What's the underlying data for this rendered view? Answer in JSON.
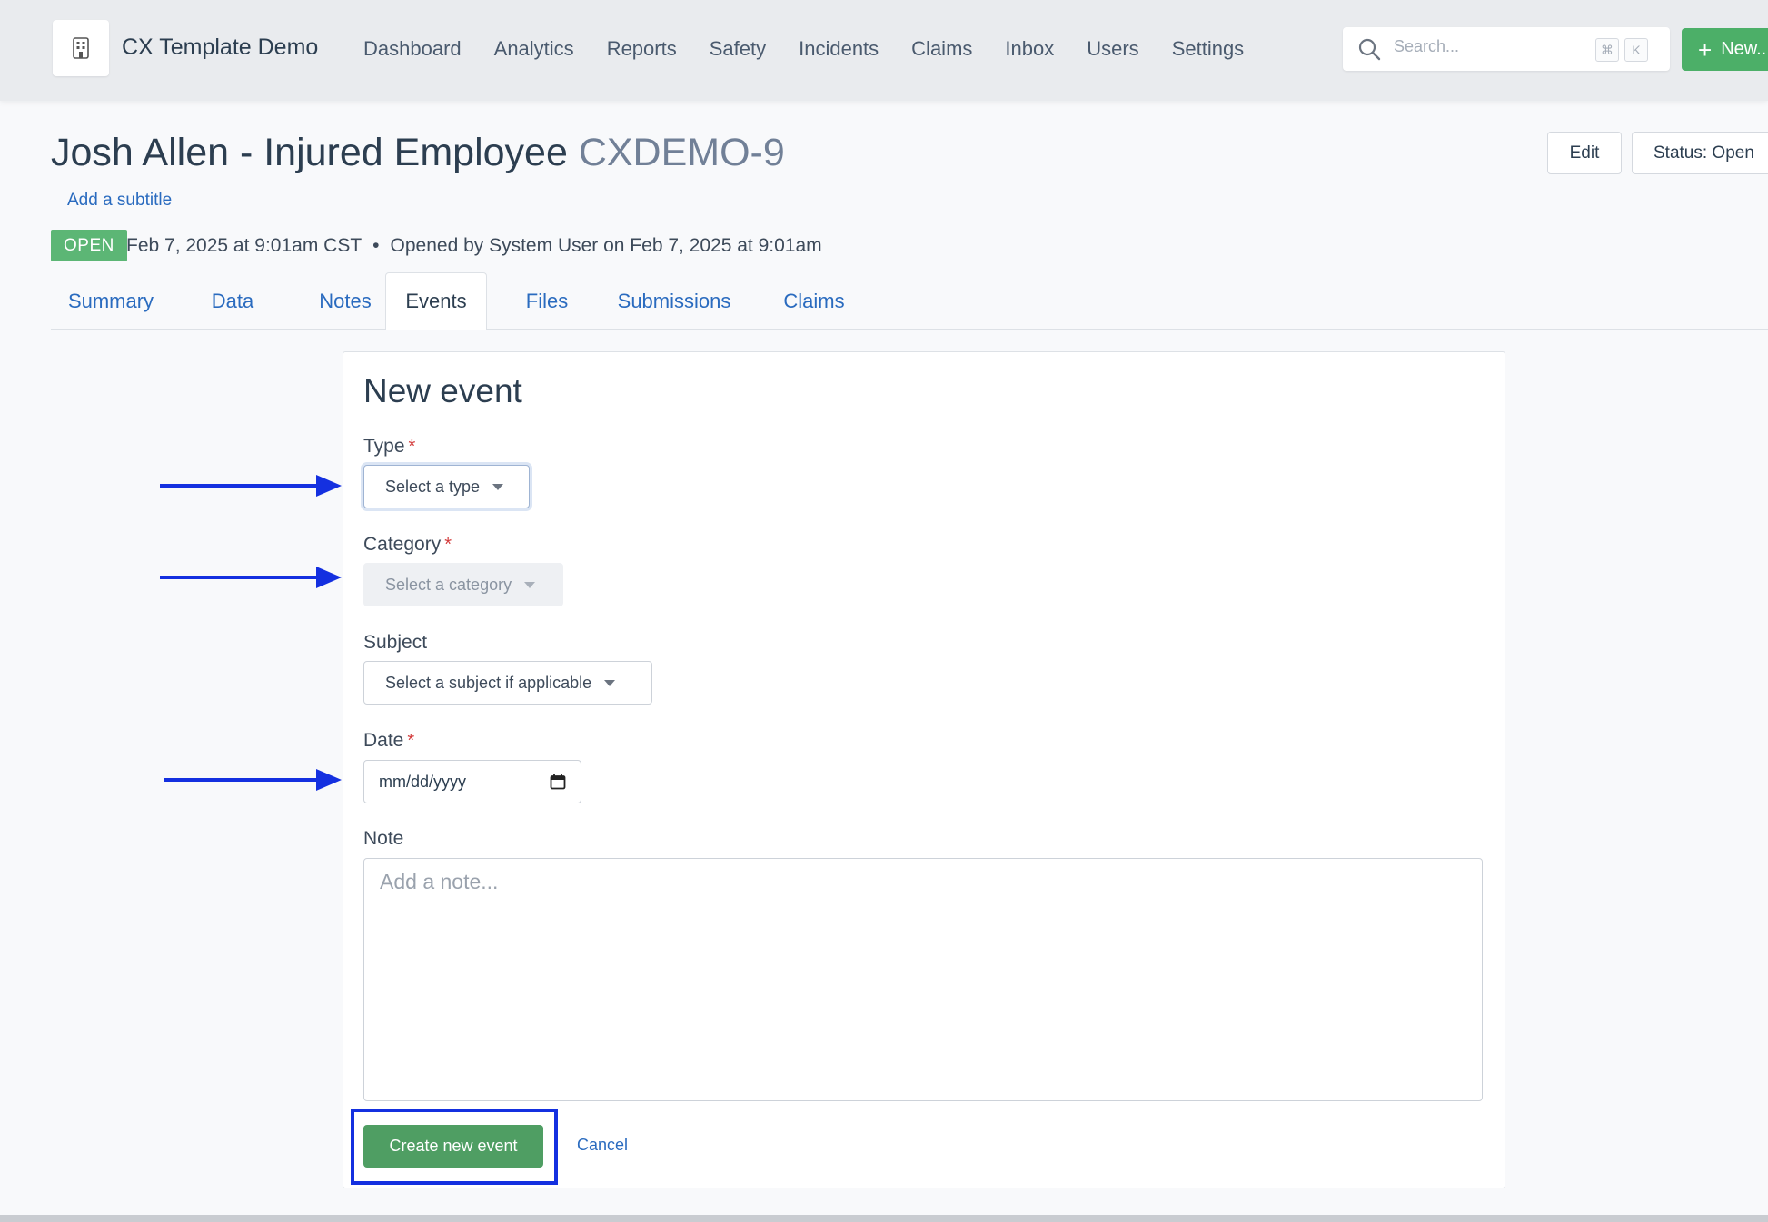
{
  "app": {
    "title": "CX Template Demo"
  },
  "nav": {
    "items": [
      "Dashboard",
      "Analytics",
      "Reports",
      "Safety",
      "Incidents",
      "Claims",
      "Inbox",
      "Users",
      "Settings"
    ]
  },
  "search": {
    "placeholder": "Search...",
    "shortcut_cmd": "⌘",
    "shortcut_key": "K"
  },
  "new_button": {
    "label": "New..."
  },
  "record": {
    "title": "Josh Allen - Injured Employee",
    "code": "CXDEMO-9",
    "subtitle_link": "Add a subtitle",
    "status_badge": "OPEN",
    "date": "Feb 7, 2025 at 9:01am CST",
    "opened_by": "Opened by System User on Feb 7, 2025 at 9:01am"
  },
  "actions": {
    "edit": "Edit",
    "status": "Status: Open"
  },
  "tabs": [
    "Summary",
    "Data",
    "Notes",
    "Events",
    "Files",
    "Submissions",
    "Claims"
  ],
  "active_tab": "Events",
  "form": {
    "title": "New event",
    "type_label": "Type",
    "type_placeholder": "Select a type",
    "category_label": "Category",
    "category_placeholder": "Select a category",
    "subject_label": "Subject",
    "subject_placeholder": "Select a subject if applicable",
    "date_label": "Date",
    "date_placeholder": "mm/dd/yyyy",
    "note_label": "Note",
    "note_placeholder": "Add a note...",
    "required_mark": "*",
    "submit": "Create new event",
    "cancel": "Cancel"
  },
  "colors": {
    "accent_green": "#4f9e63",
    "link_blue": "#2a6bbf",
    "annotation_blue": "#1430e0",
    "badge_green": "#5cb675"
  }
}
